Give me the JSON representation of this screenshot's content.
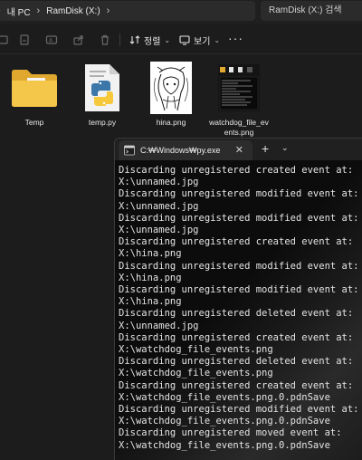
{
  "explorer": {
    "breadcrumb": [
      "내 PC",
      "RamDisk (X:)"
    ],
    "search_placeholder": "RamDisk (X:) 검색",
    "toolbar": {
      "sort_label": "정렬",
      "view_label": "보기",
      "more_label": "···"
    },
    "files": [
      {
        "name": "Temp",
        "icon": "folder-icon"
      },
      {
        "name": "temp.py",
        "icon": "python-file-icon"
      },
      {
        "name": "hina.png",
        "icon": "image-thumbnail"
      },
      {
        "name": "watchdog_file_events.png",
        "icon": "image-thumbnail"
      }
    ]
  },
  "terminal": {
    "tab_title": "C:₩Windows₩py.exe",
    "new_tab_label": "+",
    "lines": [
      "Discarding unregistered created event at:",
      "X:\\unnamed.jpg",
      "Discarding unregistered modified event at:",
      "X:\\unnamed.jpg",
      "Discarding unregistered modified event at:",
      "X:\\unnamed.jpg",
      "Discarding unregistered created event at:",
      "X:\\hina.png",
      "Discarding unregistered modified event at:",
      "X:\\hina.png",
      "Discarding unregistered modified event at:",
      "X:\\hina.png",
      "Discarding unregistered deleted event at:",
      "X:\\unnamed.jpg",
      "Discarding unregistered created event at:",
      "X:\\watchdog_file_events.png",
      "Discarding unregistered deleted event at:",
      "X:\\watchdog_file_events.png",
      "Discarding unregistered created event at:",
      "X:\\watchdog_file_events.png.0.pdnSave",
      "Discarding unregistered modified event at:",
      "X:\\watchdog_file_events.png.0.pdnSave",
      "Discarding unregistered moved event at:",
      "X:\\watchdog_file_events.png.0.pdnSave"
    ]
  }
}
